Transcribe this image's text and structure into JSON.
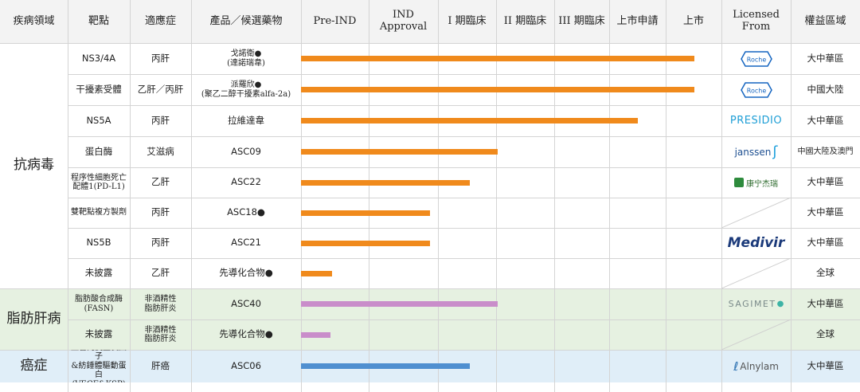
{
  "header": {
    "disease_area": "疾病領域",
    "target": "靶點",
    "indication": "適應症",
    "product": "產品／候選藥物",
    "licensed_from": "Licensed\nFrom",
    "rights_region": "權益區域"
  },
  "chart_data": {
    "type": "bar",
    "stages": [
      "Pre-IND",
      "IND\nApproval",
      "I 期臨床",
      "II 期臨床",
      "III 期臨床",
      "上市申請",
      "上市"
    ],
    "groups": [
      {
        "name": "抗病毒",
        "color": "#ffffff",
        "bar_color": "#f08a1c",
        "rows": 8
      },
      {
        "name": "脂肪肝病",
        "color": "#e6f1e1",
        "bar_color": "#c98dca",
        "rows": 2
      },
      {
        "name": "癌症",
        "color": "#e0eef8",
        "bar_color": "#4f8fd0",
        "rows": 1
      }
    ],
    "rows": [
      {
        "group": 0,
        "target": "NS3/4A",
        "target_sans": true,
        "target_small": false,
        "indication": "丙肝",
        "ind_small": false,
        "product": "戈諾衛●\n(達諾瑞韋)",
        "prod_sans": false,
        "prod_small": true,
        "progress": 7.0,
        "licensor": "Roche",
        "logo": "roche",
        "region": "大中華區"
      },
      {
        "group": 0,
        "target": "干擾素受體",
        "target_sans": false,
        "target_small": false,
        "indication": "乙肝／丙肝",
        "ind_small": false,
        "product": "派羅欣●\n(聚乙二醇干擾素alfa-2a)",
        "prod_sans": false,
        "prod_small": true,
        "progress": 7.0,
        "licensor": "Roche",
        "logo": "roche",
        "region": "中國大陸"
      },
      {
        "group": 0,
        "target": "NS5A",
        "target_sans": true,
        "target_small": false,
        "indication": "丙肝",
        "ind_small": false,
        "product": "拉維達韋",
        "prod_sans": false,
        "prod_small": false,
        "progress": 6.0,
        "licensor": "PRESIDIO",
        "logo": "presidio",
        "region": "大中華區"
      },
      {
        "group": 0,
        "target": "蛋白酶",
        "target_sans": false,
        "target_small": false,
        "indication": "艾滋病",
        "ind_small": false,
        "product": "ASC09",
        "prod_sans": true,
        "prod_small": false,
        "progress": 3.5,
        "licensor": "janssen",
        "logo": "janssen",
        "region": "中國大陸及澳門"
      },
      {
        "group": 0,
        "target": "程序性細胞死亡\n配體1(PD-L1)",
        "target_sans": false,
        "target_small": true,
        "indication": "乙肝",
        "ind_small": false,
        "product": "ASC22",
        "prod_sans": true,
        "prod_small": false,
        "progress": 3.0,
        "licensor": "康宁杰瑞",
        "logo": "alphamab",
        "region": "大中華區"
      },
      {
        "group": 0,
        "target": "雙靶點複方製劑",
        "target_sans": false,
        "target_small": true,
        "indication": "丙肝",
        "ind_small": false,
        "product": "ASC18●",
        "prod_sans": true,
        "prod_small": false,
        "progress": 2.3,
        "licensor": "",
        "logo": "none",
        "region": "大中華區"
      },
      {
        "group": 0,
        "target": "NS5B",
        "target_sans": true,
        "target_small": false,
        "indication": "丙肝",
        "ind_small": false,
        "product": "ASC21",
        "prod_sans": true,
        "prod_small": false,
        "progress": 2.3,
        "licensor": "Medivir",
        "logo": "medivir",
        "region": "大中華區"
      },
      {
        "group": 0,
        "target": "未披露",
        "target_sans": false,
        "target_small": false,
        "indication": "乙肝",
        "ind_small": false,
        "product": "先導化合物●",
        "prod_sans": false,
        "prod_small": false,
        "progress": 0.55,
        "licensor": "",
        "logo": "none",
        "region": "全球"
      },
      {
        "group": 1,
        "target": "脂肪酸合成酶\n(FASN)",
        "target_sans": false,
        "target_small": true,
        "indication": "非酒精性\n脂肪肝炎",
        "ind_small": true,
        "product": "ASC40",
        "prod_sans": true,
        "prod_small": false,
        "progress": 3.5,
        "licensor": "SAGIMET",
        "logo": "sagimet",
        "region": "大中華區"
      },
      {
        "group": 1,
        "target": "未披露",
        "target_sans": false,
        "target_small": false,
        "indication": "非酒精性\n脂肪肝炎",
        "ind_small": true,
        "product": "先導化合物●",
        "prod_sans": false,
        "prod_small": false,
        "progress": 0.53,
        "licensor": "",
        "logo": "none",
        "region": "全球"
      },
      {
        "group": 2,
        "target": "血管內皮生長因子\n&紡錘體驅動蛋白\n(VEGF&KSP)",
        "target_sans": false,
        "target_small": true,
        "indication": "肝癌",
        "ind_small": false,
        "product": "ASC06",
        "prod_sans": true,
        "prod_small": false,
        "progress": 3.0,
        "licensor": "Alnylam",
        "logo": "alnylam",
        "region": "大中華區"
      }
    ]
  }
}
